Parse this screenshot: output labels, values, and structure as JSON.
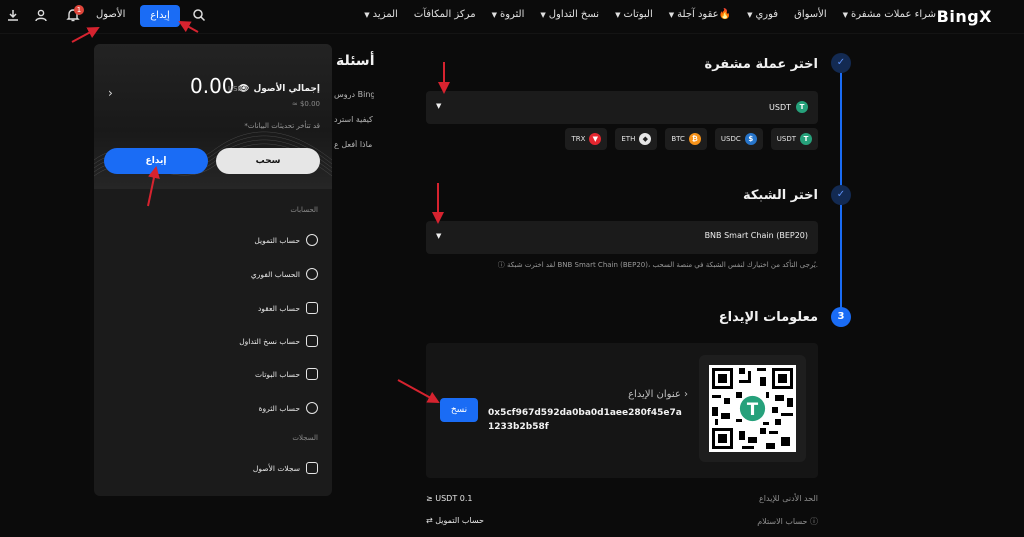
{
  "topbar": {
    "logo": "BingX",
    "nav": [
      {
        "label": "شراء عملات مشفرة",
        "caret": true
      },
      {
        "label": "الأسواق",
        "caret": false
      },
      {
        "label": "فوري",
        "caret": true
      },
      {
        "label": "عقود آجلة🔥",
        "caret": true
      },
      {
        "label": "البوتات",
        "caret": true
      },
      {
        "label": "نسخ التداول",
        "caret": true
      },
      {
        "label": "الثروة",
        "caret": true
      },
      {
        "label": "مركز المكافآت",
        "caret": false
      },
      {
        "label": "المزيد",
        "caret": true
      }
    ],
    "deposit_label": "إيداع",
    "assets_label": "الأصول",
    "notif_count": "1",
    "icons": [
      "search-icon",
      "bell-icon",
      "user-icon",
      "download-icon"
    ]
  },
  "steps": {
    "s1_title": "اختر عملة مشفرة",
    "s1_selected": "USDT",
    "s2_title": "اختر الشبكة",
    "s2_selected": "BNB Smart Chain (BEP20)",
    "s3_num": "3",
    "s3_title": "معلومات الإيداع",
    "network_note": "ⓘ لقد اخترت شبكة BNB Smart Chain (BEP20)، يُرجى التأكد من اختيارك لنفس الشبكة في منصة السحب.",
    "coins": [
      {
        "name": "USDT",
        "color": "#26a17b",
        "glyph": "T"
      },
      {
        "name": "USDC",
        "color": "#2775ca",
        "glyph": "$"
      },
      {
        "name": "BTC",
        "color": "#f7931a",
        "glyph": "₿"
      },
      {
        "name": "ETH",
        "color": "#e6e6e6",
        "glyph": "◆"
      },
      {
        "name": "TRX",
        "color": "#e3262f",
        "glyph": "▼"
      }
    ]
  },
  "deposit": {
    "address_label": "عنوان الإيداع  ›",
    "address": "0x5cf967d592da0ba0d1aee280f45e7a1233b2b58f",
    "copy_label": "نسخ",
    "min_label": "الحد الأدنى للإيداع",
    "min_value": "≥ USDT 0.1",
    "receive_label": "حساب الاستلام ⓘ",
    "receive_value": "⇄ حساب التمويل"
  },
  "faq": {
    "title": "أسئلة",
    "items": [
      "دروس BingX",
      "كيفية استرد",
      "ماذا أفعل ع"
    ]
  },
  "panel": {
    "balance_label": "إجمالي الأصول",
    "balance_value": "0.00",
    "balance_unit": "USDT",
    "balance_sub": "≈ $0.00",
    "delay_note": "*قد تتأخر تحديثات البيانات",
    "withdraw_label": "سحب",
    "deposit_label": "إيداع",
    "accounts_title": "الحسابات",
    "records_title": "السجلات",
    "items": [
      {
        "label": "حساب التمويل",
        "icon": "pie-chart-icon"
      },
      {
        "label": "الحساب الفوري",
        "icon": "spot-icon"
      },
      {
        "label": "حساب العقود",
        "icon": "contract-icon"
      },
      {
        "label": "حساب نسخ التداول",
        "icon": "copy-trade-icon"
      },
      {
        "label": "حساب البوتات",
        "icon": "bot-icon"
      },
      {
        "label": "حساب الثروة",
        "icon": "wealth-icon"
      }
    ],
    "records_item": "سجلات الأصول"
  }
}
